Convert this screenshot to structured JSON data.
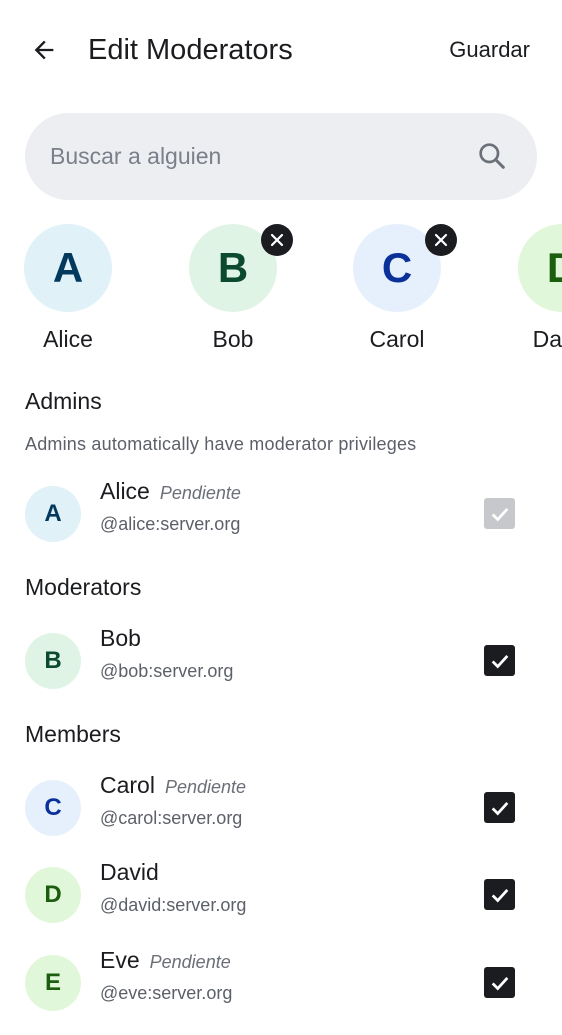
{
  "header": {
    "title": "Edit Moderators",
    "save_label": "Guardar",
    "back_icon": "arrow-left-icon"
  },
  "search": {
    "placeholder": "Buscar a alguien",
    "value": "",
    "icon": "search-icon"
  },
  "selected": [
    {
      "initial": "A",
      "name": "Alice",
      "removable": false
    },
    {
      "initial": "B",
      "name": "Bob",
      "removable": true
    },
    {
      "initial": "C",
      "name": "Carol",
      "removable": true
    },
    {
      "initial": "D",
      "name": "David",
      "removable": false
    }
  ],
  "sections": {
    "admins": {
      "title": "Admins",
      "description": "Admins automatically have moderator privileges"
    },
    "moderators": {
      "title": "Moderators"
    },
    "members": {
      "title": "Members"
    }
  },
  "members": [
    {
      "initial": "A",
      "name": "Alice",
      "status": "Pendiente",
      "id": "@alice:server.org",
      "checked": true,
      "disabled": true
    },
    {
      "initial": "B",
      "name": "Bob",
      "status": "",
      "id": "@bob:server.org",
      "checked": true,
      "disabled": false
    },
    {
      "initial": "C",
      "name": "Carol",
      "status": "Pendiente",
      "id": "@carol:server.org",
      "checked": true,
      "disabled": false
    },
    {
      "initial": "D",
      "name": "David",
      "status": "",
      "id": "@david:server.org",
      "checked": true,
      "disabled": false
    },
    {
      "initial": "E",
      "name": "Eve",
      "status": "Pendiente",
      "id": "@eve:server.org",
      "checked": true,
      "disabled": false
    }
  ],
  "colors": {
    "surface": "#ffffff",
    "on_surface": "#1b1c1f",
    "search_bg": "#eceef2",
    "checkbox_on": "#1b1c1f",
    "checkbox_disabled": "#c6c8cc"
  }
}
